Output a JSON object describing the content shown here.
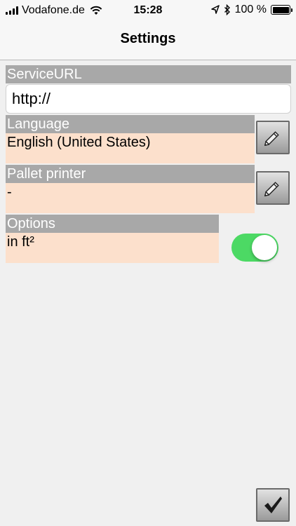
{
  "status_bar": {
    "carrier": "Vodafone.de",
    "time": "15:28",
    "battery_percent": "100 %",
    "icons": [
      "signal-icon",
      "wifi-icon",
      "location-icon",
      "bluetooth-icon",
      "battery-icon"
    ]
  },
  "nav": {
    "title": "Settings"
  },
  "service_url": {
    "header": "ServiceURL",
    "value": "http://"
  },
  "language": {
    "header": "Language",
    "value": "English (United States)",
    "edit_icon": "pencil-icon"
  },
  "pallet_printer": {
    "header": "Pallet printer",
    "value": "-",
    "edit_icon": "pencil-icon"
  },
  "options": {
    "header": "Options",
    "value": "in ft²",
    "toggle_on": true
  },
  "confirm": {
    "icon": "checkmark-icon"
  },
  "colors": {
    "header_bg": "#a8a8a8",
    "value_bg": "#fce0cc",
    "toggle_on": "#4cd964",
    "page_bg": "#f0f0f0"
  }
}
